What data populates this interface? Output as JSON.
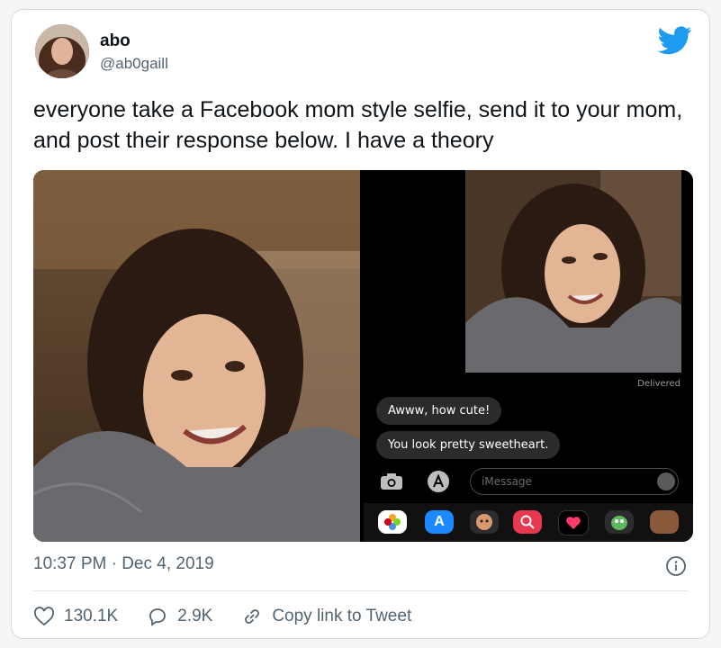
{
  "tweet": {
    "name": "abo",
    "handle": "@ab0gaill",
    "text": "everyone take a Facebook mom style selfie, send it to your mom, and post their response below. I have a theory",
    "timestamp": "10:37 PM · Dec 4, 2019"
  },
  "imessage": {
    "delivered": "Delivered",
    "messages": [
      "Awww, how cute!",
      "You look pretty sweetheart."
    ],
    "input_placeholder": "iMessage"
  },
  "actions": {
    "likes": "130.1K",
    "replies": "2.9K",
    "copy_link": "Copy link to Tweet"
  },
  "colors": {
    "twitter_blue": "#1d9bf0",
    "text_primary": "#0f1419",
    "text_secondary": "#536471"
  },
  "icons": [
    "twitter-bird-icon",
    "info-icon",
    "heart-icon",
    "reply-icon",
    "link-icon",
    "camera-icon",
    "app-store-icon",
    "audio-icon",
    "photos-icon"
  ]
}
